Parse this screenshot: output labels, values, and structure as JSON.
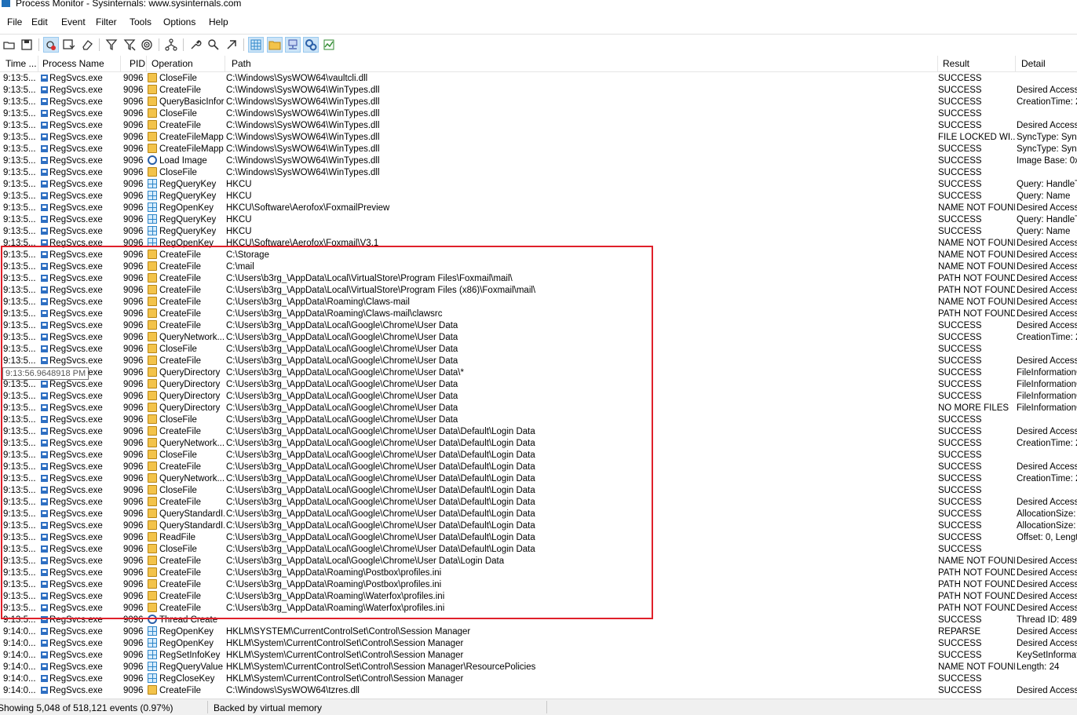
{
  "window": {
    "title": "Process Monitor - Sysinternals: www.sysinternals.com"
  },
  "menu": [
    "File",
    "Edit",
    "Event",
    "Filter",
    "Tools",
    "Options",
    "Help"
  ],
  "toolbar": {
    "buttons": [
      "open-icon",
      "save-icon",
      "capture-icon",
      "autoscroll-icon",
      "clear-icon",
      "filter-icon",
      "highlight-icon",
      "include-process-icon",
      "process-tree-icon",
      "properties-icon",
      "find-icon",
      "jump-to-icon",
      "registry-activity-icon",
      "file-activity-icon",
      "network-activity-icon",
      "process-activity-icon",
      "profiling-icon"
    ],
    "pressed": [
      "capture-icon",
      "registry-activity-icon",
      "file-activity-icon",
      "network-activity-icon",
      "process-activity-icon"
    ]
  },
  "columns": {
    "time": "Time ...",
    "process": "Process Name",
    "pid": "PID",
    "operation": "Operation",
    "path": "Path",
    "result": "Result",
    "detail": "Detail"
  },
  "rows": [
    {
      "time": "9:13:5...",
      "proc": "RegSvcs.exe",
      "pid": "9096",
      "op": "CloseFile",
      "icon": "file",
      "path": "C:\\Windows\\SysWOW64\\vaultcli.dll",
      "result": "SUCCESS",
      "detail": ""
    },
    {
      "time": "9:13:5...",
      "proc": "RegSvcs.exe",
      "pid": "9096",
      "op": "CreateFile",
      "icon": "file",
      "path": "C:\\Windows\\SysWOW64\\WinTypes.dll",
      "result": "SUCCESS",
      "detail": "Desired Access:"
    },
    {
      "time": "9:13:5...",
      "proc": "RegSvcs.exe",
      "pid": "9096",
      "op": "QueryBasicInfor...",
      "icon": "file",
      "path": "C:\\Windows\\SysWOW64\\WinTypes.dll",
      "result": "SUCCESS",
      "detail": "CreationTime: 2("
    },
    {
      "time": "9:13:5...",
      "proc": "RegSvcs.exe",
      "pid": "9096",
      "op": "CloseFile",
      "icon": "file",
      "path": "C:\\Windows\\SysWOW64\\WinTypes.dll",
      "result": "SUCCESS",
      "detail": ""
    },
    {
      "time": "9:13:5...",
      "proc": "RegSvcs.exe",
      "pid": "9096",
      "op": "CreateFile",
      "icon": "file",
      "path": "C:\\Windows\\SysWOW64\\WinTypes.dll",
      "result": "SUCCESS",
      "detail": "Desired Access:"
    },
    {
      "time": "9:13:5...",
      "proc": "RegSvcs.exe",
      "pid": "9096",
      "op": "CreateFileMapp...",
      "icon": "file",
      "path": "C:\\Windows\\SysWOW64\\WinTypes.dll",
      "result": "FILE LOCKED WI...",
      "detail": "SyncType: Sync"
    },
    {
      "time": "9:13:5...",
      "proc": "RegSvcs.exe",
      "pid": "9096",
      "op": "CreateFileMapp...",
      "icon": "file",
      "path": "C:\\Windows\\SysWOW64\\WinTypes.dll",
      "result": "SUCCESS",
      "detail": "SyncType: Sync"
    },
    {
      "time": "9:13:5...",
      "proc": "RegSvcs.exe",
      "pid": "9096",
      "op": "Load Image",
      "icon": "proc",
      "path": "C:\\Windows\\SysWOW64\\WinTypes.dll",
      "result": "SUCCESS",
      "detail": "Image Base: 0x6"
    },
    {
      "time": "9:13:5...",
      "proc": "RegSvcs.exe",
      "pid": "9096",
      "op": "CloseFile",
      "icon": "file",
      "path": "C:\\Windows\\SysWOW64\\WinTypes.dll",
      "result": "SUCCESS",
      "detail": ""
    },
    {
      "time": "9:13:5...",
      "proc": "RegSvcs.exe",
      "pid": "9096",
      "op": "RegQueryKey",
      "icon": "reg",
      "path": "HKCU",
      "result": "SUCCESS",
      "detail": "Query: HandleTa"
    },
    {
      "time": "9:13:5...",
      "proc": "RegSvcs.exe",
      "pid": "9096",
      "op": "RegQueryKey",
      "icon": "reg",
      "path": "HKCU",
      "result": "SUCCESS",
      "detail": "Query: Name"
    },
    {
      "time": "9:13:5...",
      "proc": "RegSvcs.exe",
      "pid": "9096",
      "op": "RegOpenKey",
      "icon": "reg",
      "path": "HKCU\\Software\\Aerofox\\FoxmailPreview",
      "result": "NAME NOT FOUND",
      "detail": "Desired Access:"
    },
    {
      "time": "9:13:5...",
      "proc": "RegSvcs.exe",
      "pid": "9096",
      "op": "RegQueryKey",
      "icon": "reg",
      "path": "HKCU",
      "result": "SUCCESS",
      "detail": "Query: HandleTa"
    },
    {
      "time": "9:13:5...",
      "proc": "RegSvcs.exe",
      "pid": "9096",
      "op": "RegQueryKey",
      "icon": "reg",
      "path": "HKCU",
      "result": "SUCCESS",
      "detail": "Query: Name"
    },
    {
      "time": "9:13:5...",
      "proc": "RegSvcs.exe",
      "pid": "9096",
      "op": "RegOpenKey",
      "icon": "reg",
      "path": "HKCU\\Software\\Aerofox\\Foxmail\\V3.1",
      "result": "NAME NOT FOUND",
      "detail": "Desired Access:"
    },
    {
      "time": "9:13:5...",
      "proc": "RegSvcs.exe",
      "pid": "9096",
      "op": "CreateFile",
      "icon": "file",
      "path": "C:\\Storage",
      "result": "NAME NOT FOUND",
      "detail": "Desired Access:"
    },
    {
      "time": "9:13:5...",
      "proc": "RegSvcs.exe",
      "pid": "9096",
      "op": "CreateFile",
      "icon": "file",
      "path": "C:\\mail",
      "result": "NAME NOT FOUND",
      "detail": "Desired Access:"
    },
    {
      "time": "9:13:5...",
      "proc": "RegSvcs.exe",
      "pid": "9096",
      "op": "CreateFile",
      "icon": "file",
      "path": "C:\\Users\\b3rg_\\AppData\\Local\\VirtualStore\\Program Files\\Foxmail\\mail\\",
      "result": "PATH NOT FOUND",
      "detail": "Desired Access:"
    },
    {
      "time": "9:13:5...",
      "proc": "RegSvcs.exe",
      "pid": "9096",
      "op": "CreateFile",
      "icon": "file",
      "path": "C:\\Users\\b3rg_\\AppData\\Local\\VirtualStore\\Program Files (x86)\\Foxmail\\mail\\",
      "result": "PATH NOT FOUND",
      "detail": "Desired Access:"
    },
    {
      "time": "9:13:5...",
      "proc": "RegSvcs.exe",
      "pid": "9096",
      "op": "CreateFile",
      "icon": "file",
      "path": "C:\\Users\\b3rg_\\AppData\\Roaming\\Claws-mail",
      "result": "NAME NOT FOUND",
      "detail": "Desired Access:"
    },
    {
      "time": "9:13:5...",
      "proc": "RegSvcs.exe",
      "pid": "9096",
      "op": "CreateFile",
      "icon": "file",
      "path": "C:\\Users\\b3rg_\\AppData\\Roaming\\Claws-mail\\clawsrc",
      "result": "PATH NOT FOUND",
      "detail": "Desired Access:"
    },
    {
      "time": "9:13:5...",
      "proc": "RegSvcs.exe",
      "pid": "9096",
      "op": "CreateFile",
      "icon": "file",
      "path": "C:\\Users\\b3rg_\\AppData\\Local\\Google\\Chrome\\User Data",
      "result": "SUCCESS",
      "detail": "Desired Access:"
    },
    {
      "time": "9:13:5...",
      "proc": "RegSvcs.exe",
      "pid": "9096",
      "op": "QueryNetwork...",
      "icon": "file",
      "path": "C:\\Users\\b3rg_\\AppData\\Local\\Google\\Chrome\\User Data",
      "result": "SUCCESS",
      "detail": "CreationTime: 2("
    },
    {
      "time": "9:13:5...",
      "proc": "RegSvcs.exe",
      "pid": "9096",
      "op": "CloseFile",
      "icon": "file",
      "path": "C:\\Users\\b3rg_\\AppData\\Local\\Google\\Chrome\\User Data",
      "result": "SUCCESS",
      "detail": ""
    },
    {
      "time": "9:13:5...",
      "proc": "RegSvcs.exe",
      "pid": "9096",
      "op": "CreateFile",
      "icon": "file",
      "path": "C:\\Users\\b3rg_\\AppData\\Local\\Google\\Chrome\\User Data",
      "result": "SUCCESS",
      "detail": "Desired Access:"
    },
    {
      "time": "9:13:5...",
      "proc": "RegSvcs.exe",
      "pid": "9096",
      "op": "QueryDirectory",
      "icon": "file",
      "path": "C:\\Users\\b3rg_\\AppData\\Local\\Google\\Chrome\\User Data\\*",
      "result": "SUCCESS",
      "detail": "FileInformationCl"
    },
    {
      "time": "9:13:5...",
      "proc": "RegSvcs.exe",
      "pid": "9096",
      "op": "QueryDirectory",
      "icon": "file",
      "path": "C:\\Users\\b3rg_\\AppData\\Local\\Google\\Chrome\\User Data",
      "result": "SUCCESS",
      "detail": "FileInformationCl"
    },
    {
      "time": "9:13:5...",
      "proc": "RegSvcs.exe",
      "pid": "9096",
      "op": "QueryDirectory",
      "icon": "file",
      "path": "C:\\Users\\b3rg_\\AppData\\Local\\Google\\Chrome\\User Data",
      "result": "SUCCESS",
      "detail": "FileInformationCl"
    },
    {
      "time": "9:13:5...",
      "proc": "RegSvcs.exe",
      "pid": "9096",
      "op": "QueryDirectory",
      "icon": "file",
      "path": "C:\\Users\\b3rg_\\AppData\\Local\\Google\\Chrome\\User Data",
      "result": "NO MORE FILES",
      "detail": "FileInformationCl"
    },
    {
      "time": "9:13:5...",
      "proc": "RegSvcs.exe",
      "pid": "9096",
      "op": "CloseFile",
      "icon": "file",
      "path": "C:\\Users\\b3rg_\\AppData\\Local\\Google\\Chrome\\User Data",
      "result": "SUCCESS",
      "detail": ""
    },
    {
      "time": "9:13:5...",
      "proc": "RegSvcs.exe",
      "pid": "9096",
      "op": "CreateFile",
      "icon": "file",
      "path": "C:\\Users\\b3rg_\\AppData\\Local\\Google\\Chrome\\User Data\\Default\\Login Data",
      "result": "SUCCESS",
      "detail": "Desired Access:"
    },
    {
      "time": "9:13:5...",
      "proc": "RegSvcs.exe",
      "pid": "9096",
      "op": "QueryNetwork...",
      "icon": "file",
      "path": "C:\\Users\\b3rg_\\AppData\\Local\\Google\\Chrome\\User Data\\Default\\Login Data",
      "result": "SUCCESS",
      "detail": "CreationTime: 2("
    },
    {
      "time": "9:13:5...",
      "proc": "RegSvcs.exe",
      "pid": "9096",
      "op": "CloseFile",
      "icon": "file",
      "path": "C:\\Users\\b3rg_\\AppData\\Local\\Google\\Chrome\\User Data\\Default\\Login Data",
      "result": "SUCCESS",
      "detail": ""
    },
    {
      "time": "9:13:5...",
      "proc": "RegSvcs.exe",
      "pid": "9096",
      "op": "CreateFile",
      "icon": "file",
      "path": "C:\\Users\\b3rg_\\AppData\\Local\\Google\\Chrome\\User Data\\Default\\Login Data",
      "result": "SUCCESS",
      "detail": "Desired Access:"
    },
    {
      "time": "9:13:5...",
      "proc": "RegSvcs.exe",
      "pid": "9096",
      "op": "QueryNetwork...",
      "icon": "file",
      "path": "C:\\Users\\b3rg_\\AppData\\Local\\Google\\Chrome\\User Data\\Default\\Login Data",
      "result": "SUCCESS",
      "detail": "CreationTime: 2("
    },
    {
      "time": "9:13:5...",
      "proc": "RegSvcs.exe",
      "pid": "9096",
      "op": "CloseFile",
      "icon": "file",
      "path": "C:\\Users\\b3rg_\\AppData\\Local\\Google\\Chrome\\User Data\\Default\\Login Data",
      "result": "SUCCESS",
      "detail": ""
    },
    {
      "time": "9:13:5...",
      "proc": "RegSvcs.exe",
      "pid": "9096",
      "op": "CreateFile",
      "icon": "file",
      "path": "C:\\Users\\b3rg_\\AppData\\Local\\Google\\Chrome\\User Data\\Default\\Login Data",
      "result": "SUCCESS",
      "detail": "Desired Access:"
    },
    {
      "time": "9:13:5...",
      "proc": "RegSvcs.exe",
      "pid": "9096",
      "op": "QueryStandardI...",
      "icon": "file",
      "path": "C:\\Users\\b3rg_\\AppData\\Local\\Google\\Chrome\\User Data\\Default\\Login Data",
      "result": "SUCCESS",
      "detail": "AllocationSize: 4"
    },
    {
      "time": "9:13:5...",
      "proc": "RegSvcs.exe",
      "pid": "9096",
      "op": "QueryStandardI...",
      "icon": "file",
      "path": "C:\\Users\\b3rg_\\AppData\\Local\\Google\\Chrome\\User Data\\Default\\Login Data",
      "result": "SUCCESS",
      "detail": "AllocationSize: 4"
    },
    {
      "time": "9:13:5...",
      "proc": "RegSvcs.exe",
      "pid": "9096",
      "op": "ReadFile",
      "icon": "file",
      "path": "C:\\Users\\b3rg_\\AppData\\Local\\Google\\Chrome\\User Data\\Default\\Login Data",
      "result": "SUCCESS",
      "detail": "Offset: 0, Length"
    },
    {
      "time": "9:13:5...",
      "proc": "RegSvcs.exe",
      "pid": "9096",
      "op": "CloseFile",
      "icon": "file",
      "path": "C:\\Users\\b3rg_\\AppData\\Local\\Google\\Chrome\\User Data\\Default\\Login Data",
      "result": "SUCCESS",
      "detail": ""
    },
    {
      "time": "9:13:5...",
      "proc": "RegSvcs.exe",
      "pid": "9096",
      "op": "CreateFile",
      "icon": "file",
      "path": "C:\\Users\\b3rg_\\AppData\\Local\\Google\\Chrome\\User Data\\Login Data",
      "result": "NAME NOT FOUND",
      "detail": "Desired Access:"
    },
    {
      "time": "9:13:5...",
      "proc": "RegSvcs.exe",
      "pid": "9096",
      "op": "CreateFile",
      "icon": "file",
      "path": "C:\\Users\\b3rg_\\AppData\\Roaming\\Postbox\\profiles.ini",
      "result": "PATH NOT FOUND",
      "detail": "Desired Access:"
    },
    {
      "time": "9:13:5...",
      "proc": "RegSvcs.exe",
      "pid": "9096",
      "op": "CreateFile",
      "icon": "file",
      "path": "C:\\Users\\b3rg_\\AppData\\Roaming\\Postbox\\profiles.ini",
      "result": "PATH NOT FOUND",
      "detail": "Desired Access:"
    },
    {
      "time": "9:13:5...",
      "proc": "RegSvcs.exe",
      "pid": "9096",
      "op": "CreateFile",
      "icon": "file",
      "path": "C:\\Users\\b3rg_\\AppData\\Roaming\\Waterfox\\profiles.ini",
      "result": "PATH NOT FOUND",
      "detail": "Desired Access:"
    },
    {
      "time": "9:13:5...",
      "proc": "RegSvcs.exe",
      "pid": "9096",
      "op": "CreateFile",
      "icon": "file",
      "path": "C:\\Users\\b3rg_\\AppData\\Roaming\\Waterfox\\profiles.ini",
      "result": "PATH NOT FOUND",
      "detail": "Desired Access:"
    },
    {
      "time": "9:13:5...",
      "proc": "RegSvcs.exe",
      "pid": "9096",
      "op": "Thread Create",
      "icon": "proc",
      "path": "",
      "result": "SUCCESS",
      "detail": "Thread ID: 4892"
    },
    {
      "time": "9:14:0...",
      "proc": "RegSvcs.exe",
      "pid": "9096",
      "op": "RegOpenKey",
      "icon": "reg",
      "path": "HKLM\\SYSTEM\\CurrentControlSet\\Control\\Session Manager",
      "result": "REPARSE",
      "detail": "Desired Access:"
    },
    {
      "time": "9:14:0...",
      "proc": "RegSvcs.exe",
      "pid": "9096",
      "op": "RegOpenKey",
      "icon": "reg",
      "path": "HKLM\\System\\CurrentControlSet\\Control\\Session Manager",
      "result": "SUCCESS",
      "detail": "Desired Access:"
    },
    {
      "time": "9:14:0...",
      "proc": "RegSvcs.exe",
      "pid": "9096",
      "op": "RegSetInfoKey",
      "icon": "reg",
      "path": "HKLM\\System\\CurrentControlSet\\Control\\Session Manager",
      "result": "SUCCESS",
      "detail": "KeySetInformatic"
    },
    {
      "time": "9:14:0...",
      "proc": "RegSvcs.exe",
      "pid": "9096",
      "op": "RegQueryValue",
      "icon": "reg",
      "path": "HKLM\\System\\CurrentControlSet\\Control\\Session Manager\\ResourcePolicies",
      "result": "NAME NOT FOUND",
      "detail": "Length: 24"
    },
    {
      "time": "9:14:0...",
      "proc": "RegSvcs.exe",
      "pid": "9096",
      "op": "RegCloseKey",
      "icon": "reg",
      "path": "HKLM\\System\\CurrentControlSet\\Control\\Session Manager",
      "result": "SUCCESS",
      "detail": ""
    },
    {
      "time": "9:14:0...",
      "proc": "RegSvcs.exe",
      "pid": "9096",
      "op": "CreateFile",
      "icon": "file",
      "path": "C:\\Windows\\SysWOW64\\tzres.dll",
      "result": "SUCCESS",
      "detail": "Desired Access:"
    }
  ],
  "tooltip": {
    "text": "9:13:56.9648918 PM"
  },
  "status": {
    "events": "Showing 5,048 of 518,121 events (0.97%)",
    "memory": "Backed by virtual memory"
  },
  "colors": {
    "highlight_box": "#e0202a",
    "accent": "#2e6fc2"
  }
}
